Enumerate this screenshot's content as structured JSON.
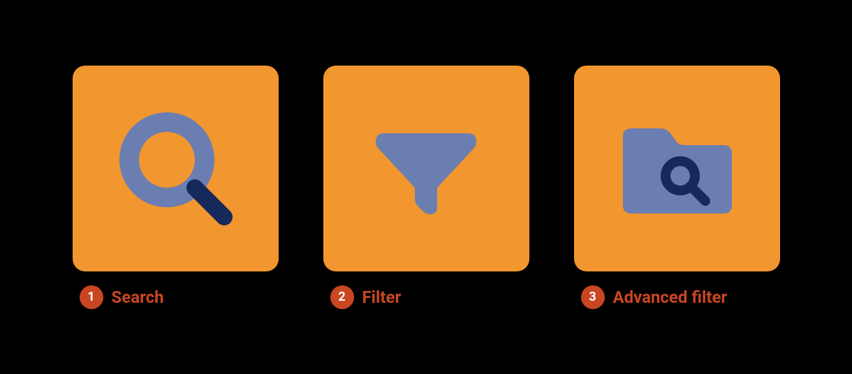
{
  "cards": [
    {
      "number": "1",
      "label": "Search",
      "icon": "search-icon"
    },
    {
      "number": "2",
      "label": "Filter",
      "icon": "filter-icon"
    },
    {
      "number": "3",
      "label": "Advanced filter",
      "icon": "folder-search-icon"
    }
  ],
  "colors": {
    "tile_bg": "#f2962f",
    "icon_primary": "#6a7eb2",
    "icon_accent": "#15295a",
    "badge_bg": "#c94622",
    "badge_text": "#ffffff",
    "caption_text": "#c94622",
    "page_bg": "#000000"
  }
}
